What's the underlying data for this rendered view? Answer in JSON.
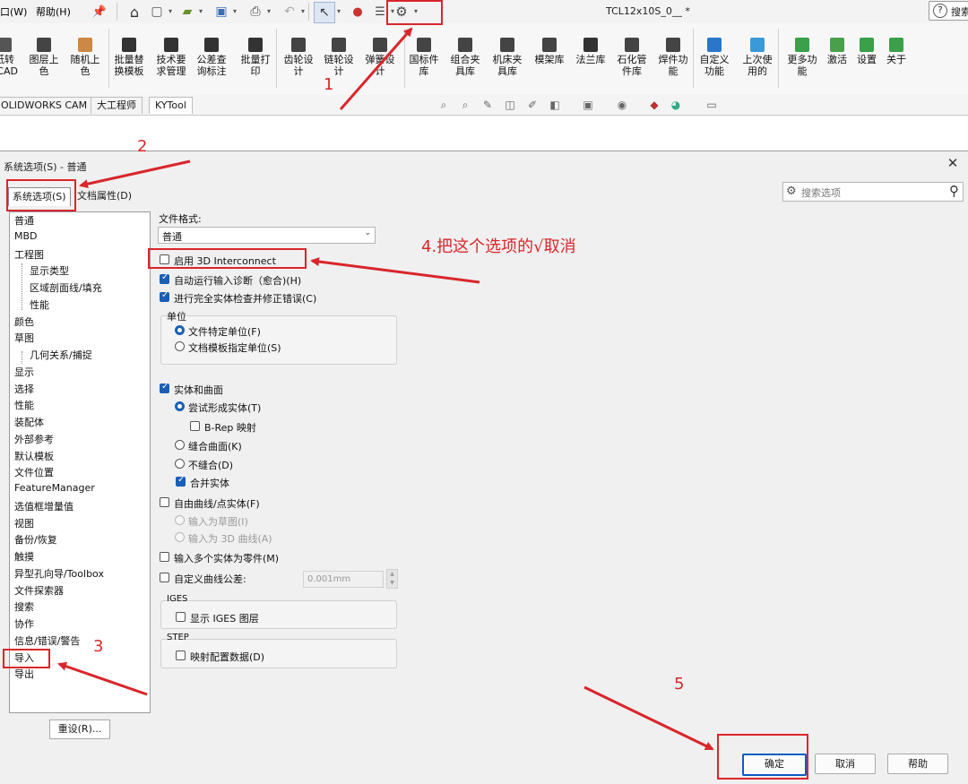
{
  "topbar": {
    "menu_view": "口(W)",
    "menu_help": "帮助(H)",
    "doc_title": "TCL12x10S_0__ *",
    "search_label": "搜索"
  },
  "ribbon": {
    "buttons": [
      "纸转 FCAD",
      "图层上 色",
      "随机上 色",
      "批量替 换模板",
      "技术要 求管理",
      "公差查 询标注",
      "批量打 印",
      "齿轮设 计",
      "链轮设 计",
      "弹簧设 计",
      "国标件 库",
      "组合夹 具库",
      "机床夹 具库",
      "模架库",
      "法兰库",
      "石化管 件库",
      "焊件功 能",
      "自定义 功能",
      "上次使 用的",
      "更多功 能",
      "激活",
      "设置",
      "关于"
    ],
    "tabs": [
      "OLIDWORKS CAM",
      "大工程师",
      "KYTool"
    ]
  },
  "dialog": {
    "title": "系统选项(S) - 普通",
    "tab_system": "系统选项(S)",
    "tab_doc": "文档属性(D)",
    "search_placeholder": "搜索选项",
    "tree": [
      {
        "label": "普通",
        "child": false
      },
      {
        "label": "MBD",
        "child": false
      },
      {
        "label": "工程图",
        "child": false
      },
      {
        "label": "显示类型",
        "child": true
      },
      {
        "label": "区域剖面线/填充",
        "child": true
      },
      {
        "label": "性能",
        "child": true
      },
      {
        "label": "颜色",
        "child": false
      },
      {
        "label": "草图",
        "child": false
      },
      {
        "label": "几何关系/捕捉",
        "child": true
      },
      {
        "label": "显示",
        "child": false
      },
      {
        "label": "选择",
        "child": false
      },
      {
        "label": "性能",
        "child": false
      },
      {
        "label": "装配体",
        "child": false
      },
      {
        "label": "外部参考",
        "child": false
      },
      {
        "label": "默认模板",
        "child": false
      },
      {
        "label": "文件位置",
        "child": false
      },
      {
        "label": "FeatureManager",
        "child": false
      },
      {
        "label": "选值框增量值",
        "child": false
      },
      {
        "label": "视图",
        "child": false
      },
      {
        "label": "备份/恢复",
        "child": false
      },
      {
        "label": "触摸",
        "child": false
      },
      {
        "label": "异型孔向导/Toolbox",
        "child": false
      },
      {
        "label": "文件探索器",
        "child": false
      },
      {
        "label": "搜索",
        "child": false
      },
      {
        "label": "协作",
        "child": false
      },
      {
        "label": "信息/错误/警告",
        "child": false
      },
      {
        "label": "导入",
        "child": false
      },
      {
        "label": "导出",
        "child": false
      }
    ],
    "reset": "重设(R)...",
    "file_format_label": "文件格式:",
    "file_format_value": "普通",
    "options": {
      "enable_3d_interconnect": "启用 3D Interconnect",
      "auto_diagnose": "自动运行输入诊断（愈合)(H)",
      "full_check": "进行完全实体检查并修正错误(C)",
      "units_group": "单位",
      "unit_file": "文件特定单位(F)",
      "unit_template": "文档模板指定单位(S)",
      "solid_surface": "实体和曲面",
      "try_solid": "尝试形成实体(T)",
      "brep": "B-Rep 映射",
      "knit": "缝合曲面(K)",
      "no_knit": "不缝合(D)",
      "merge": "合并实体",
      "free_curves": "自由曲线/点实体(F)",
      "as_sketch": "输入为草图(I)",
      "as_3d_curve": "输入为 3D 曲线(A)",
      "multi_body": "输入多个实体为零件(M)",
      "custom_tol": "自定义曲线公差:",
      "tol_value": "0.001mm",
      "iges_group": "IGES",
      "iges_layers": "显示 IGES 图层",
      "step_group": "STEP",
      "step_map": "映射配置数据(D)"
    },
    "ok": "确定",
    "cancel": "取消",
    "help": "帮助"
  },
  "annotations": {
    "n1": "1",
    "n2": "2",
    "n3": "3",
    "n5": "5",
    "note4": "4.把这个选项的√取消"
  },
  "colors": {
    "annotation": "#d9262b",
    "accent": "#1a5fb4"
  }
}
